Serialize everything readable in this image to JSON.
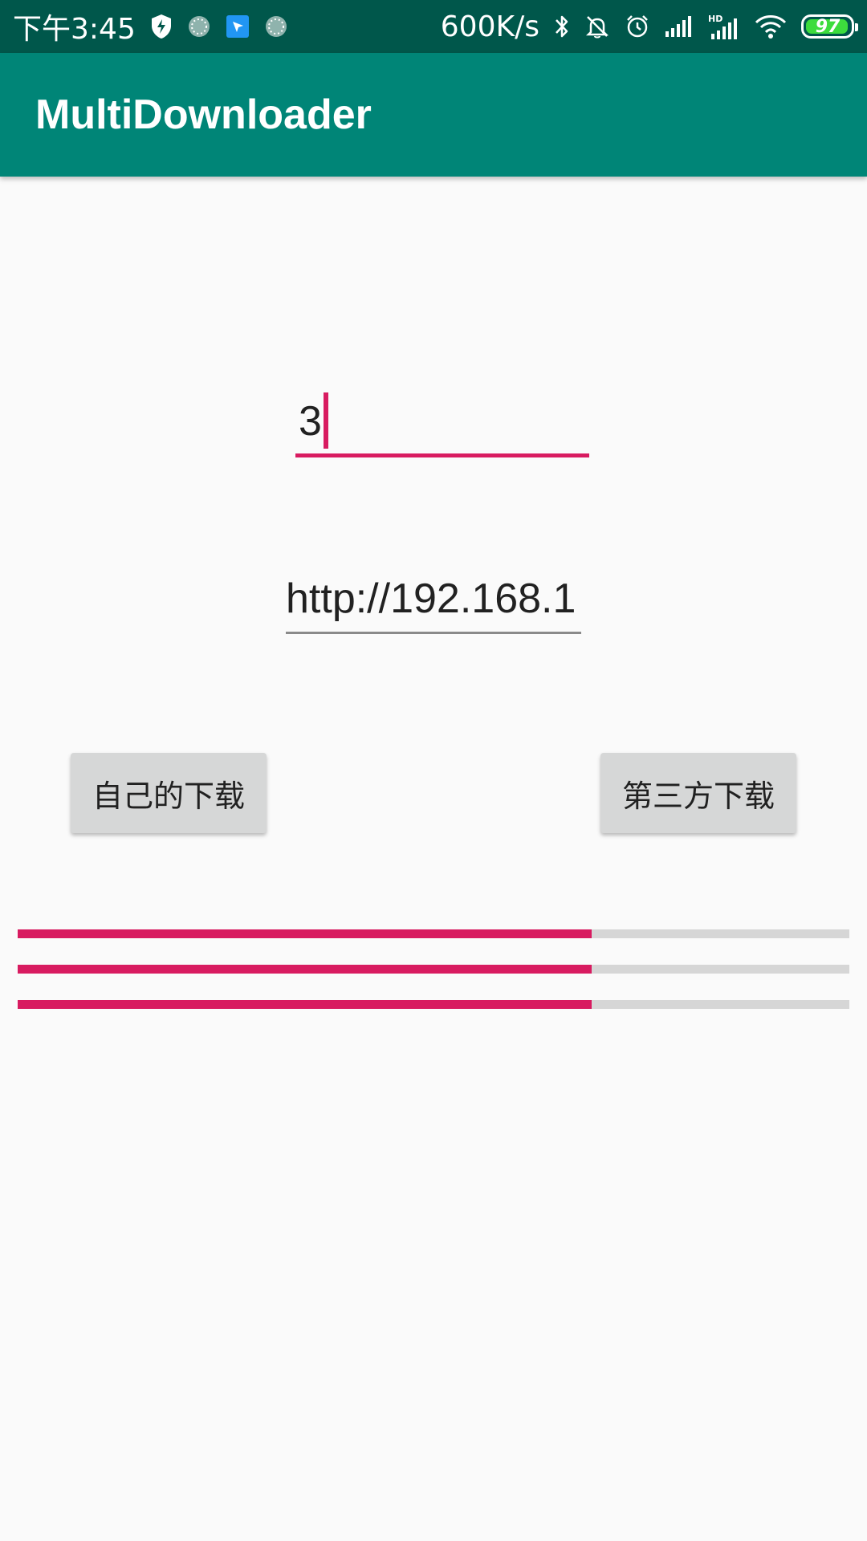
{
  "status_bar": {
    "time": "下午3:45",
    "net_speed": "600K/s",
    "battery_level": "97",
    "battery_fraction": 0.97,
    "icons": [
      "shield-icon",
      "loading-icon",
      "app-notification-icon",
      "loading-icon",
      "bluetooth-icon",
      "bell-muted-icon",
      "alarm-icon",
      "signal-icon",
      "hd-signal-icon",
      "wifi-icon",
      "battery-icon"
    ]
  },
  "app_bar": {
    "title": "MultiDownloader"
  },
  "form": {
    "thread_count": "3",
    "url": "http://192.168.1"
  },
  "buttons": {
    "own_download": "自己的下载",
    "third_party_download": "第三方下载"
  },
  "progress": [
    0.69,
    0.69,
    0.69
  ],
  "colors": {
    "primary": "#008577",
    "primary_dark": "#00574b",
    "accent": "#d81b60",
    "background": "#fafafa"
  }
}
